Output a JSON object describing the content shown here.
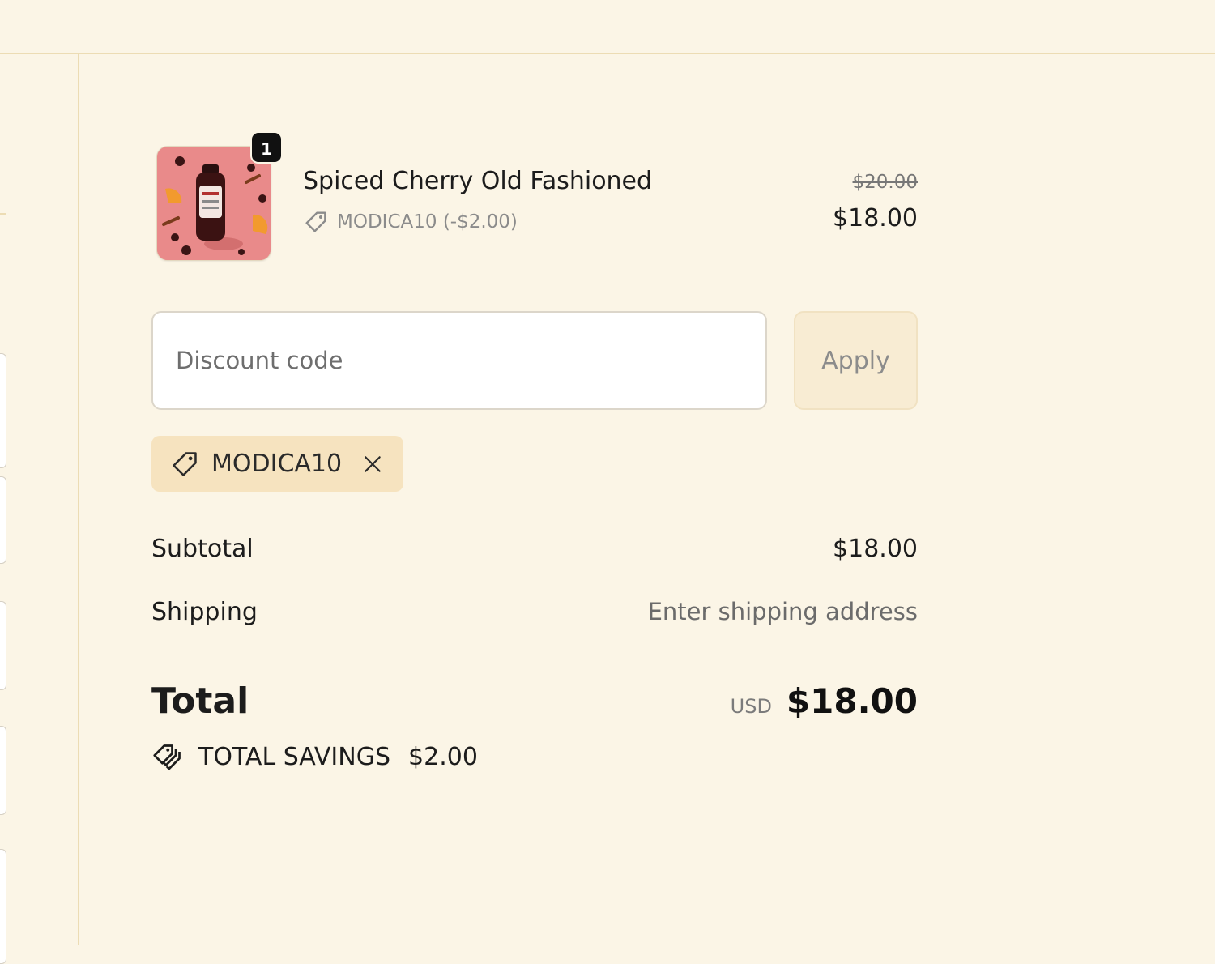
{
  "line_item": {
    "name": "Spiced Cherry Old Fashioned",
    "quantity": "1",
    "discount_line": "MODICA10 (-$2.00)",
    "original_price": "$20.00",
    "price": "$18.00",
    "thumbnail_color": "#e78b8b"
  },
  "discount_form": {
    "placeholder": "Discount code",
    "apply_label": "Apply"
  },
  "applied_code": {
    "code": "MODICA10"
  },
  "totals": {
    "subtotal_label": "Subtotal",
    "subtotal_value": "$18.00",
    "shipping_label": "Shipping",
    "shipping_value": "Enter shipping address",
    "total_label": "Total",
    "currency": "USD",
    "total_value": "$18.00",
    "savings_label": "TOTAL SAVINGS",
    "savings_value": "$2.00"
  },
  "colors": {
    "background": "#fbf5e6",
    "chip_background": "#f6e3bf",
    "apply_button_background": "#f8ecd3"
  },
  "icons": [
    "tag-icon",
    "close-icon",
    "tags-icon"
  ]
}
